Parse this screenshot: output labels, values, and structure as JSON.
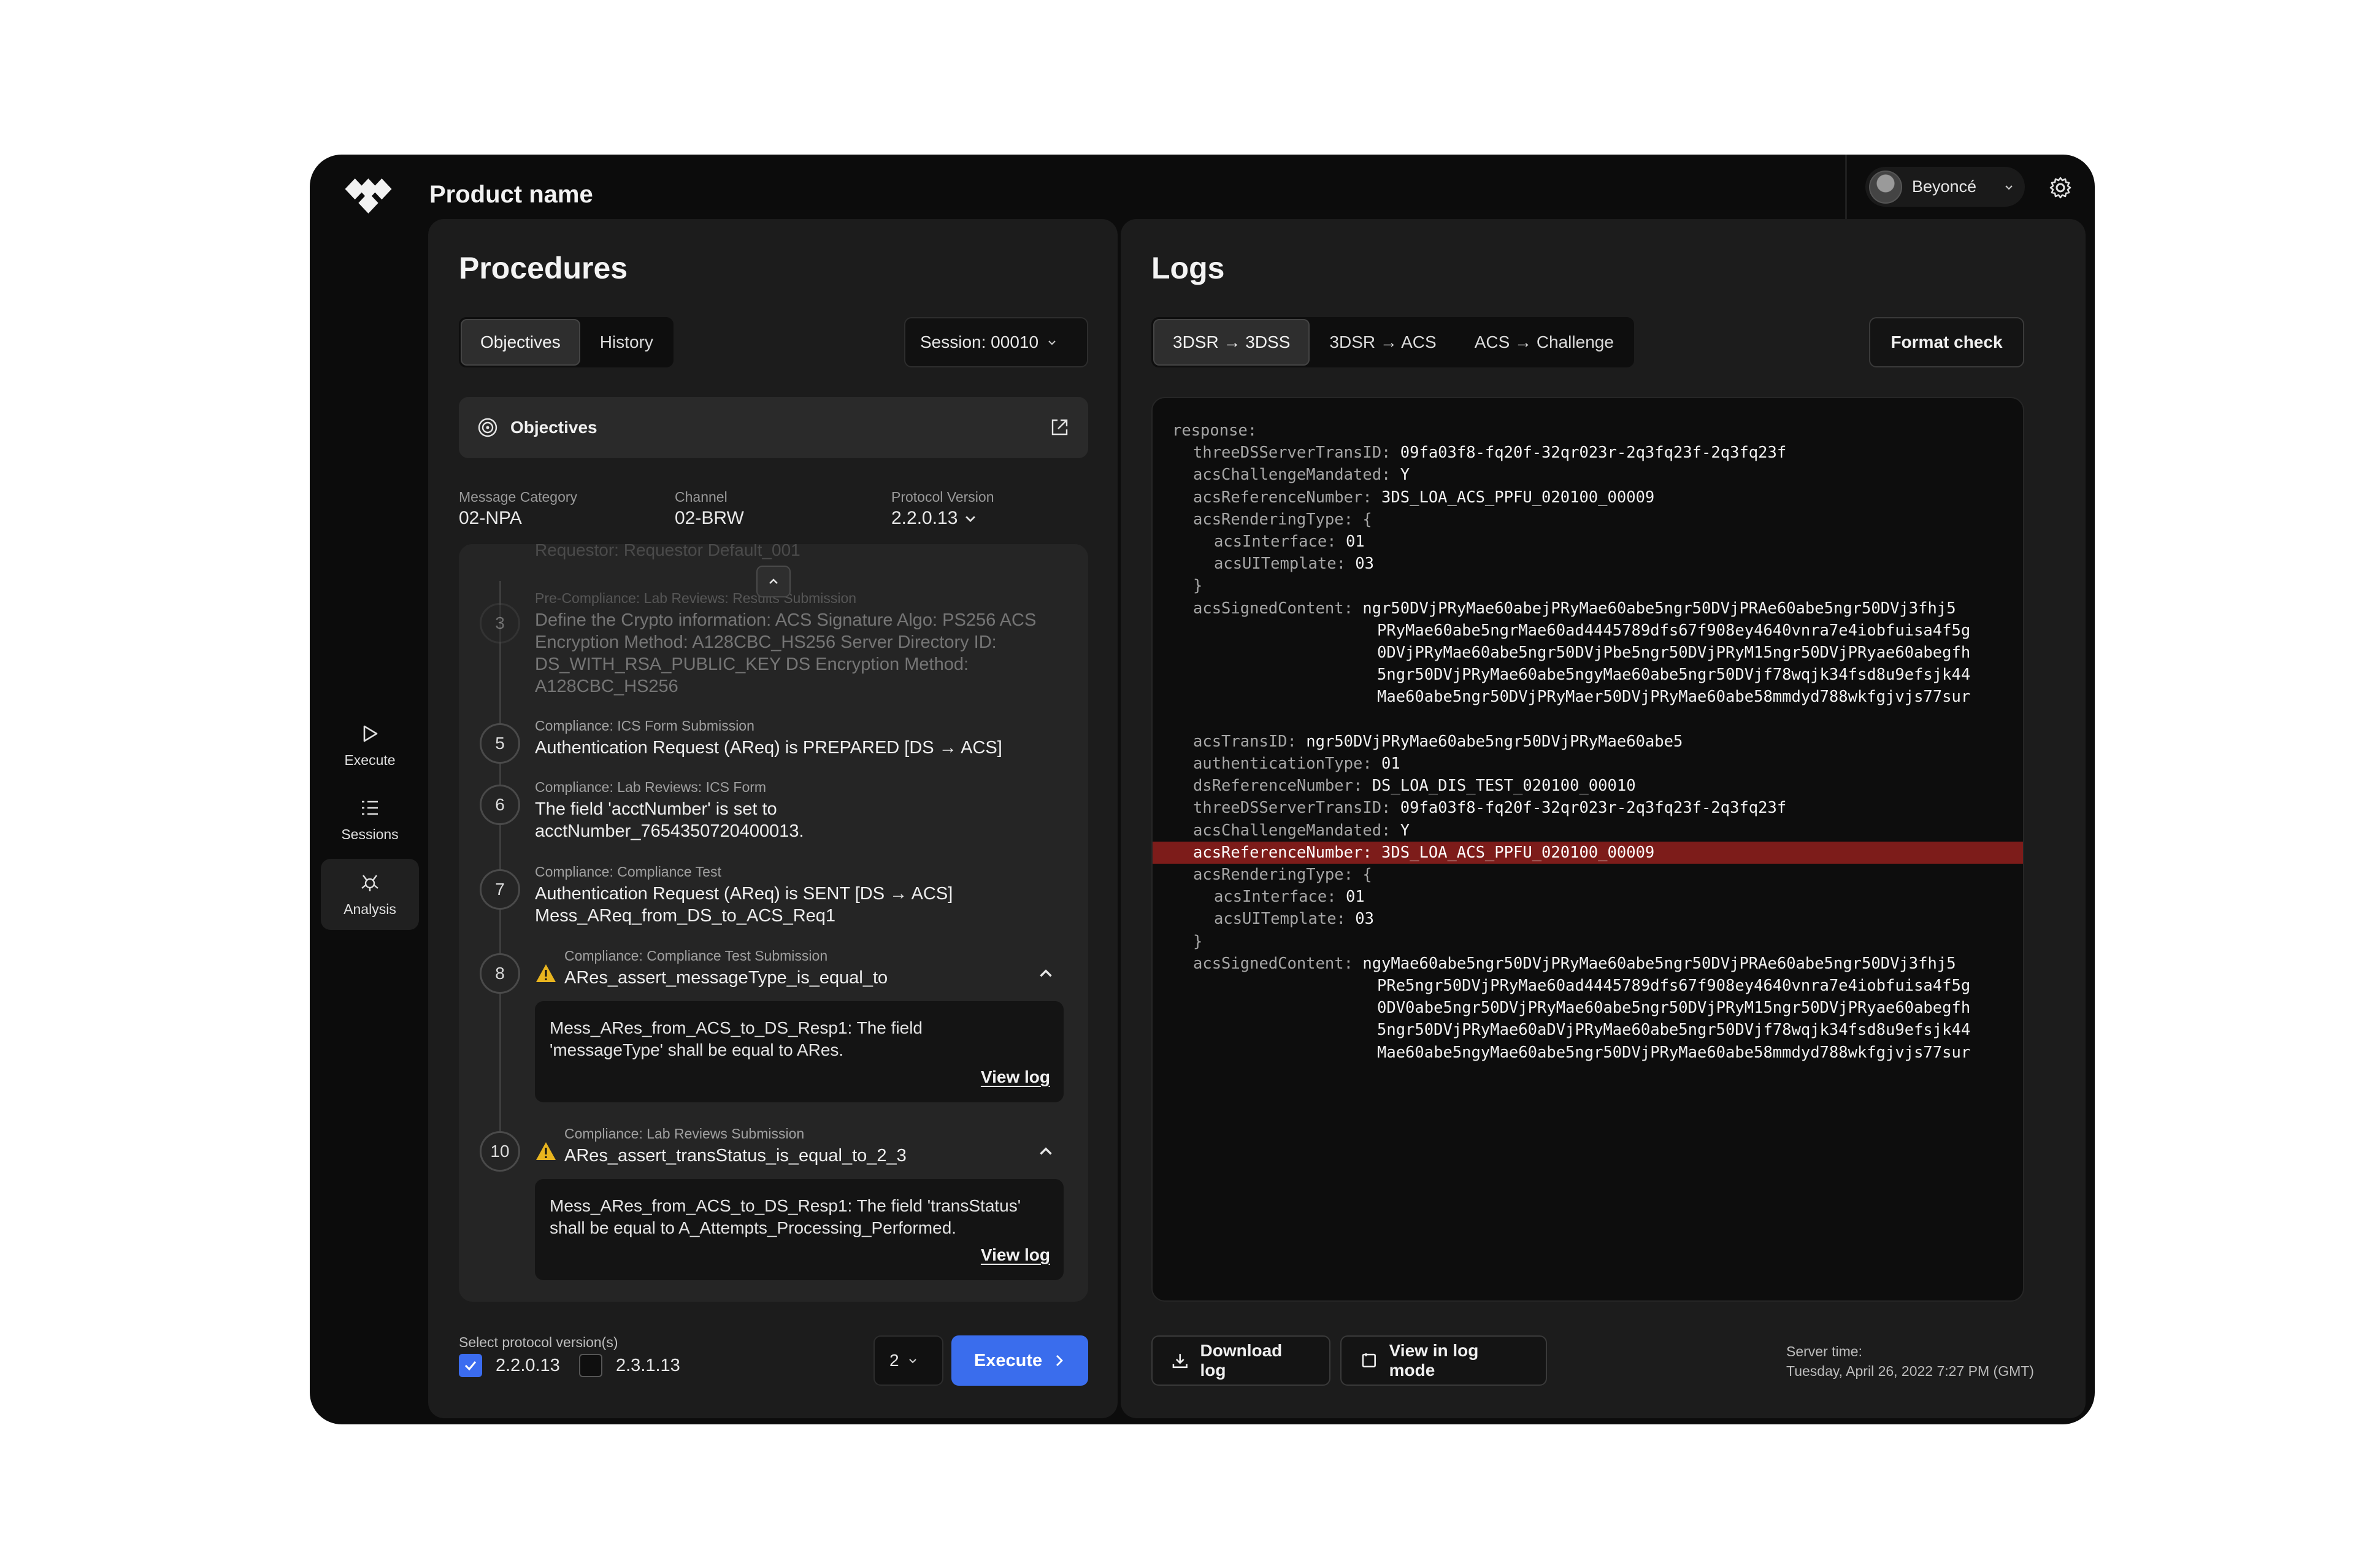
{
  "header": {
    "product_name": "Product name",
    "user_name": "Beyoncé"
  },
  "sidebar": {
    "items": [
      {
        "label": "Execute",
        "icon": "play-icon",
        "active": false
      },
      {
        "label": "Sessions",
        "icon": "list-icon",
        "active": false
      },
      {
        "label": "Analysis",
        "icon": "analysis-icon",
        "active": true
      }
    ]
  },
  "procedures": {
    "title": "Procedures",
    "tabs": [
      "Objectives",
      "History"
    ],
    "active_tab": "Objectives",
    "session_label": "Session: 00010",
    "objectives_card": "Objectives",
    "meta": {
      "message_category_label": "Message Category",
      "message_category_value": "02-NPA",
      "channel_label": "Channel",
      "channel_value": "02-BRW",
      "protocol_version_label": "Protocol Version",
      "protocol_version_value": "2.2.0.13"
    },
    "requestor_ghost": "Requestor: Requestor Default_001",
    "steps": [
      {
        "num": "3",
        "category": "Pre-Compliance: Lab Reviews: Results Submission",
        "text": [
          "Define the Crypto information: ACS Signature Algo: PS256 ACS",
          "Encryption Method: A128CBC_HS256 Server Directory ID:",
          "DS_WITH_RSA_PUBLIC_KEY DS Encryption Method:",
          "A128CBC_HS256"
        ]
      },
      {
        "num": "5",
        "category": "Compliance: ICS Form Submission",
        "text": [
          "Authentication Request (AReq) is PREPARED [DS → ACS]"
        ]
      },
      {
        "num": "6",
        "category": "Compliance: Lab Reviews: ICS Form",
        "text": [
          "The field 'acctNumber' is set to",
          "acctNumber_7654350720400013."
        ]
      },
      {
        "num": "7",
        "category": "Compliance: Compliance Test",
        "text": [
          "Authentication Request (AReq) is SENT [DS → ACS]",
          "Mess_AReq_from_DS_to_ACS_Req1"
        ]
      },
      {
        "num": "8",
        "category": "Compliance: Compliance Test Submission",
        "text": [
          "ARes_assert_messageType_is_equal_to"
        ],
        "detail": [
          "Mess_ARes_from_ACS_to_DS_Resp1: The field",
          "'messageType' shall be equal to ARes."
        ],
        "link": "View log"
      },
      {
        "num": "10",
        "category": "Compliance: Lab Reviews Submission",
        "text": [
          "ARes_assert_transStatus_is_equal_to_2_3"
        ],
        "detail": [
          "Mess_ARes_from_ACS_to_DS_Resp1: The field 'transStatus'",
          "shall be equal to A_Attempts_Processing_Performed."
        ],
        "link": "View log"
      }
    ],
    "protocol_select_label": "Select protocol version(s)",
    "protocol_options": [
      {
        "label": "2.2.0.13",
        "checked": true
      },
      {
        "label": "2.3.1.13",
        "checked": false
      }
    ],
    "count_value": "2",
    "execute_label": "Execute"
  },
  "logs": {
    "title": "Logs",
    "tabs": [
      "3DSR → 3DSS",
      "3DSR → ACS",
      "ACS → Challenge"
    ],
    "active_tab": "3DSR → 3DSS",
    "format_check": "Format check",
    "lines": [
      {
        "k": "response:",
        "v": "",
        "indent": 0
      },
      {
        "k": "threeDSServerTransID:",
        "v": " 09fa03f8-fq20f-32qr023r-2q3fq23f-2q3fq23f",
        "indent": 1
      },
      {
        "k": "acsChallengeMandated:",
        "v": " Y",
        "indent": 1
      },
      {
        "k": "acsReferenceNumber:",
        "v": " 3DS_LOA_ACS_PPFU_020100_00009",
        "indent": 1
      },
      {
        "k": "acsRenderingType: {",
        "v": "",
        "indent": 1
      },
      {
        "k": "acsInterface:",
        "v": " 01",
        "indent": 2
      },
      {
        "k": "acsUITemplate:",
        "v": " 03",
        "indent": 2
      },
      {
        "k": "}",
        "v": "",
        "indent": 1
      },
      {
        "k": "acsSignedContent:",
        "v": " ngr50DVjPRyMae60abejPRyMae60abe5ngr50DVjPRAe60abe5ngr50DVj3fhj5",
        "indent": 1
      },
      {
        "k": "",
        "v": "PRyMae60abe5ngrMae60ad4445789dfs67f908ey4640vnra7e4iobfuisa4f5g",
        "indent": 3
      },
      {
        "k": "",
        "v": "0DVjPRyMae60abe5ngr50DVjPbe5ngr50DVjPRyM15ngr50DVjPRyae60abegfh",
        "indent": 3
      },
      {
        "k": "",
        "v": "5ngr50DVjPRyMae60abe5ngyMae60abe5ngr50DVjf78wqjk34fsd8u9efsjk44",
        "indent": 3
      },
      {
        "k": "",
        "v": "Mae60abe5ngr50DVjPRyMaer50DVjPRyMae60abe58mmdyd788wkfgjvjs77sur",
        "indent": 3
      },
      {
        "k": "",
        "v": "",
        "indent": 0
      },
      {
        "k": "acsTransID:",
        "v": " ngr50DVjPRyMae60abe5ngr50DVjPRyMae60abe5",
        "indent": 1
      },
      {
        "k": "authenticationType:",
        "v": " 01",
        "indent": 1
      },
      {
        "k": "dsReferenceNumber:",
        "v": " DS_LOA_DIS_TEST_020100_00010",
        "indent": 1
      },
      {
        "k": "threeDSServerTransID:",
        "v": " 09fa03f8-fq20f-32qr023r-2q3fq23f-2q3fq23f",
        "indent": 1
      },
      {
        "k": "acsChallengeMandated:",
        "v": " Y",
        "indent": 1
      },
      {
        "k": "acsReferenceNumber:",
        "v": " 3DS_LOA_ACS_PPFU_020100_00009",
        "indent": 1,
        "highlight": true
      },
      {
        "k": "acsRenderingType: {",
        "v": "",
        "indent": 1
      },
      {
        "k": "acsInterface:",
        "v": " 01",
        "indent": 2
      },
      {
        "k": "acsUITemplate:",
        "v": " 03",
        "indent": 2
      },
      {
        "k": "}",
        "v": "",
        "indent": 1
      },
      {
        "k": "acsSignedContent:",
        "v": " ngyMae60abe5ngr50DVjPRyMae60abe5ngr50DVjPRAe60abe5ngr50DVj3fhj5",
        "indent": 1
      },
      {
        "k": "",
        "v": "PRe5ngr50DVjPRyMae60ad4445789dfs67f908ey4640vnra7e4iobfuisa4f5g",
        "indent": 3
      },
      {
        "k": "",
        "v": "0DV0abe5ngr50DVjPRyMae60abe5ngr50DVjPRyM15ngr50DVjPRyae60abegfh",
        "indent": 3
      },
      {
        "k": "",
        "v": "5ngr50DVjPRyMae60aDVjPRyMae60abe5ngr50DVjf78wqjk34fsd8u9efsjk44",
        "indent": 3
      },
      {
        "k": "",
        "v": "Mae60abe5ngyMae60abe5ngr50DVjPRyMae60abe58mmdyd788wkfgjvjs77sur",
        "indent": 3
      }
    ],
    "download_label": "Download log",
    "view_mode_label": "View in log mode",
    "server_time_label": "Server time:",
    "server_time": "Tuesday, April 26, 2022 7:27 PM (GMT)"
  },
  "colors": {
    "accent": "#3a6ded",
    "highlight": "#7d1c1a",
    "warning": "#e9b51f",
    "background": "#0c0c0c"
  }
}
